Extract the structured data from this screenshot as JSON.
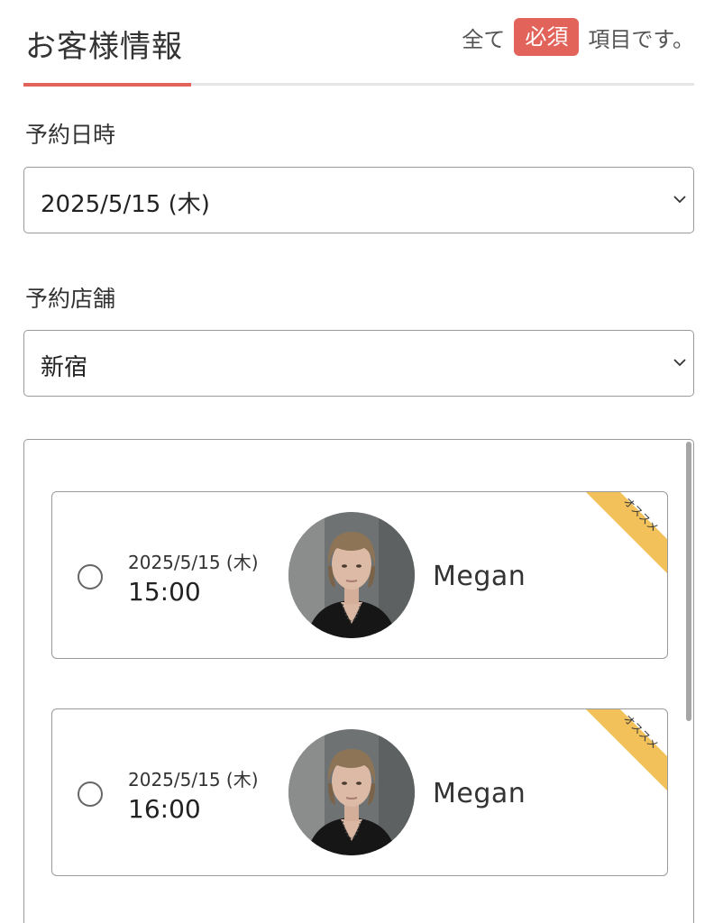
{
  "header": {
    "title": "お客様情報",
    "required_prefix": "全て",
    "required_badge": "必須",
    "required_suffix": "項目です。"
  },
  "form": {
    "date_label": "予約日時",
    "date_value": "2025/5/15 (木)",
    "store_label": "予約店舗",
    "store_value": "新宿"
  },
  "slots": [
    {
      "date": "2025/5/15 (木)",
      "time": "15:00",
      "staff": "Megan",
      "badge": "オススメ"
    },
    {
      "date": "2025/5/15 (木)",
      "time": "16:00",
      "staff": "Megan",
      "badge": "オススメ"
    }
  ],
  "colors": {
    "accent": "#e2635a",
    "ribbon": "#f2c15a",
    "border": "#9a9a9a"
  }
}
